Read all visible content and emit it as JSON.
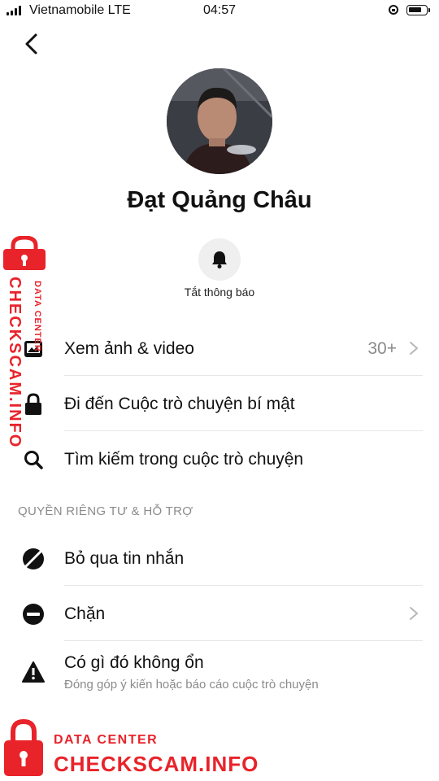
{
  "status_bar": {
    "carrier": "Vietnamobile LTE",
    "time": "04:57"
  },
  "profile": {
    "name": "Đạt Quảng Châu"
  },
  "mute": {
    "label": "Tắt thông báo"
  },
  "menu": {
    "media": {
      "label": "Xem ảnh & video",
      "value": "30+"
    },
    "secret_chat": {
      "label": "Đi đến Cuộc trò chuyện bí mật"
    },
    "search": {
      "label": "Tìm kiếm trong cuộc trò chuyện"
    }
  },
  "privacy": {
    "header": "QUYỀN RIÊNG TƯ & HỖ TRỢ",
    "ignore": {
      "label": "Bỏ qua tin nhắn"
    },
    "block": {
      "label": "Chặn"
    },
    "report": {
      "label": "Có gì đó không ổn",
      "sublabel": "Đóng góp ý kiến hoặc báo cáo cuộc trò chuyện"
    }
  },
  "watermark": {
    "line1": "DATA CENTER",
    "line2": "CHECKSCAM.INFO"
  },
  "colors": {
    "watermark_red": "#e8232a",
    "muted_gray": "#8b8b8b"
  }
}
